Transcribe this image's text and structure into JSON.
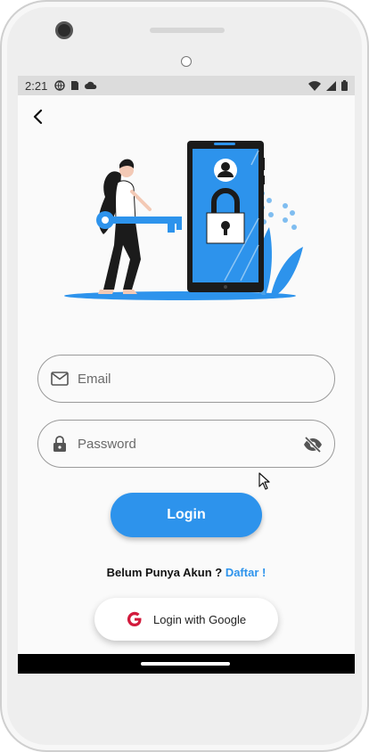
{
  "status_bar": {
    "time": "2:21",
    "left_icons": [
      "globe-icon",
      "sim-card-icon",
      "cloud-icon"
    ],
    "right_icons": [
      "wifi-icon",
      "signal-icon",
      "battery-icon"
    ]
  },
  "header": {
    "back_icon": "chevron-left-icon"
  },
  "illustration": {
    "icon": "login-illustration",
    "colors": {
      "primary": "#2d93ec",
      "dark": "#1b1b1b",
      "plant": "#5aa7e6"
    }
  },
  "form": {
    "email": {
      "placeholder": "Email",
      "value": "",
      "icon": "mail-icon"
    },
    "password": {
      "placeholder": "Password",
      "value": "",
      "icon": "lock-icon",
      "toggle_icon": "eye-off-icon"
    }
  },
  "actions": {
    "login_label": "Login",
    "signup_prompt": "Belum Punya Akun ? ",
    "signup_link": "Daftar !",
    "google_label": "Login with Google",
    "google_icon": "google-icon"
  },
  "colors": {
    "accent": "#2d93ec",
    "google_red": "#d21a3c"
  }
}
